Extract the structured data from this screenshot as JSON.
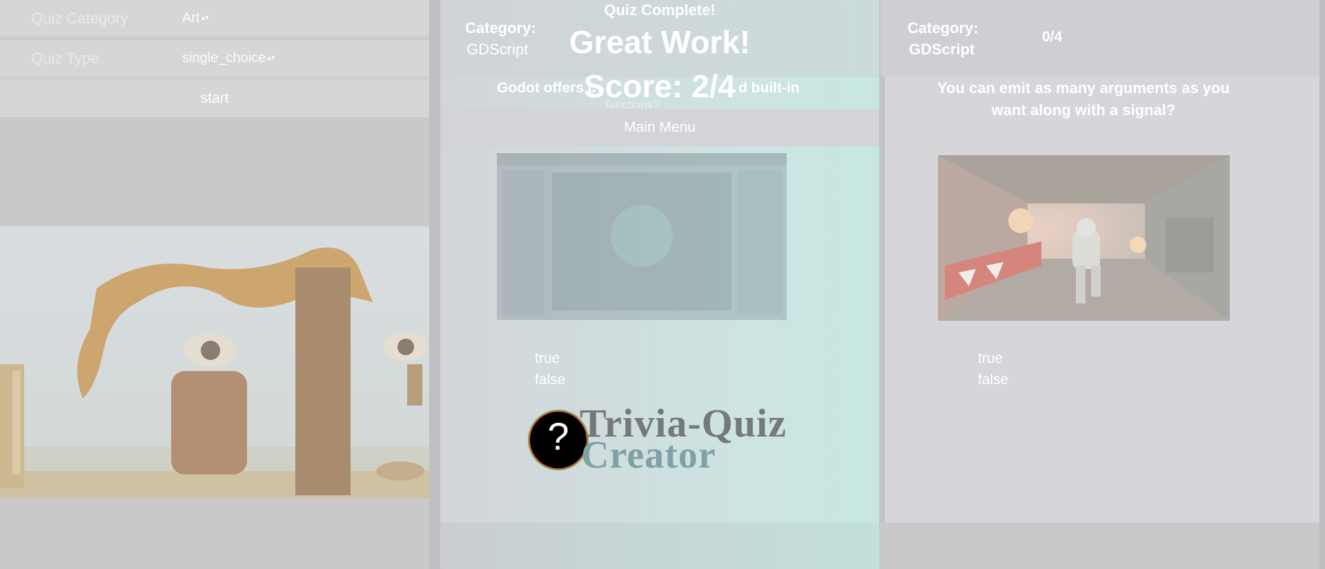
{
  "left_panel": {
    "form": [
      {
        "label": "Quiz Category",
        "value": "Art"
      },
      {
        "label": "Quiz Type",
        "value": "single_choice"
      }
    ],
    "start_label": "start",
    "image_icon": "surreal-painting-image"
  },
  "middle_panel": {
    "category_label": "Category:",
    "category_value": "GDScript",
    "question_fragments": [
      "Godot offers c",
      "d built-in"
    ],
    "question_fragment_cont": "functions?",
    "answers": [
      "true",
      "false"
    ],
    "result": {
      "heading": "Quiz Complete!",
      "message": "Great Work!",
      "score": "Score: 2/4",
      "main_menu_label": "Main Menu"
    }
  },
  "right_panel": {
    "category_label": "Category:",
    "category_value": "GDScript",
    "progress": "0/4",
    "question": "You can emit as many arguments as you want along with a signal?",
    "answers": [
      "true",
      "false"
    ],
    "image_icon": "sci-fi-corridor-image"
  },
  "logo": {
    "line1": "Trivia-Quiz",
    "line2": "Creator",
    "icon_symbol": "?"
  }
}
